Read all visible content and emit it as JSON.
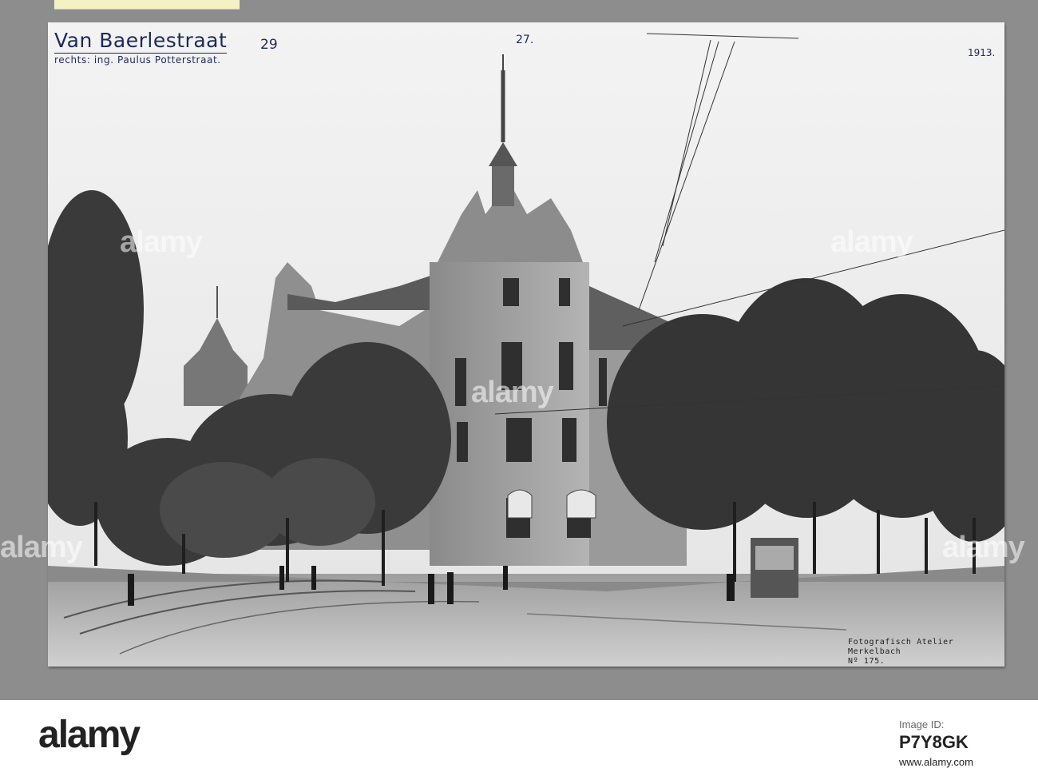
{
  "inscriptions": {
    "title": "Van Baerlestraat",
    "title_number": "29",
    "subtitle": "rechts: ing. Paulus Potterstraat.",
    "print_number": "27.",
    "year": "1913."
  },
  "studio_stamp": {
    "line1": "Fotografisch Atelier",
    "line2": "Merkelbach",
    "line3": "Nº 175."
  },
  "watermarks": [
    "alamy",
    "alamy",
    "alamy",
    "alamy",
    "alamy"
  ],
  "footer": {
    "logo": "alamy",
    "image_id_label": "Image ID:",
    "image_id": "P7Y8GK",
    "url": "www.alamy.com"
  }
}
